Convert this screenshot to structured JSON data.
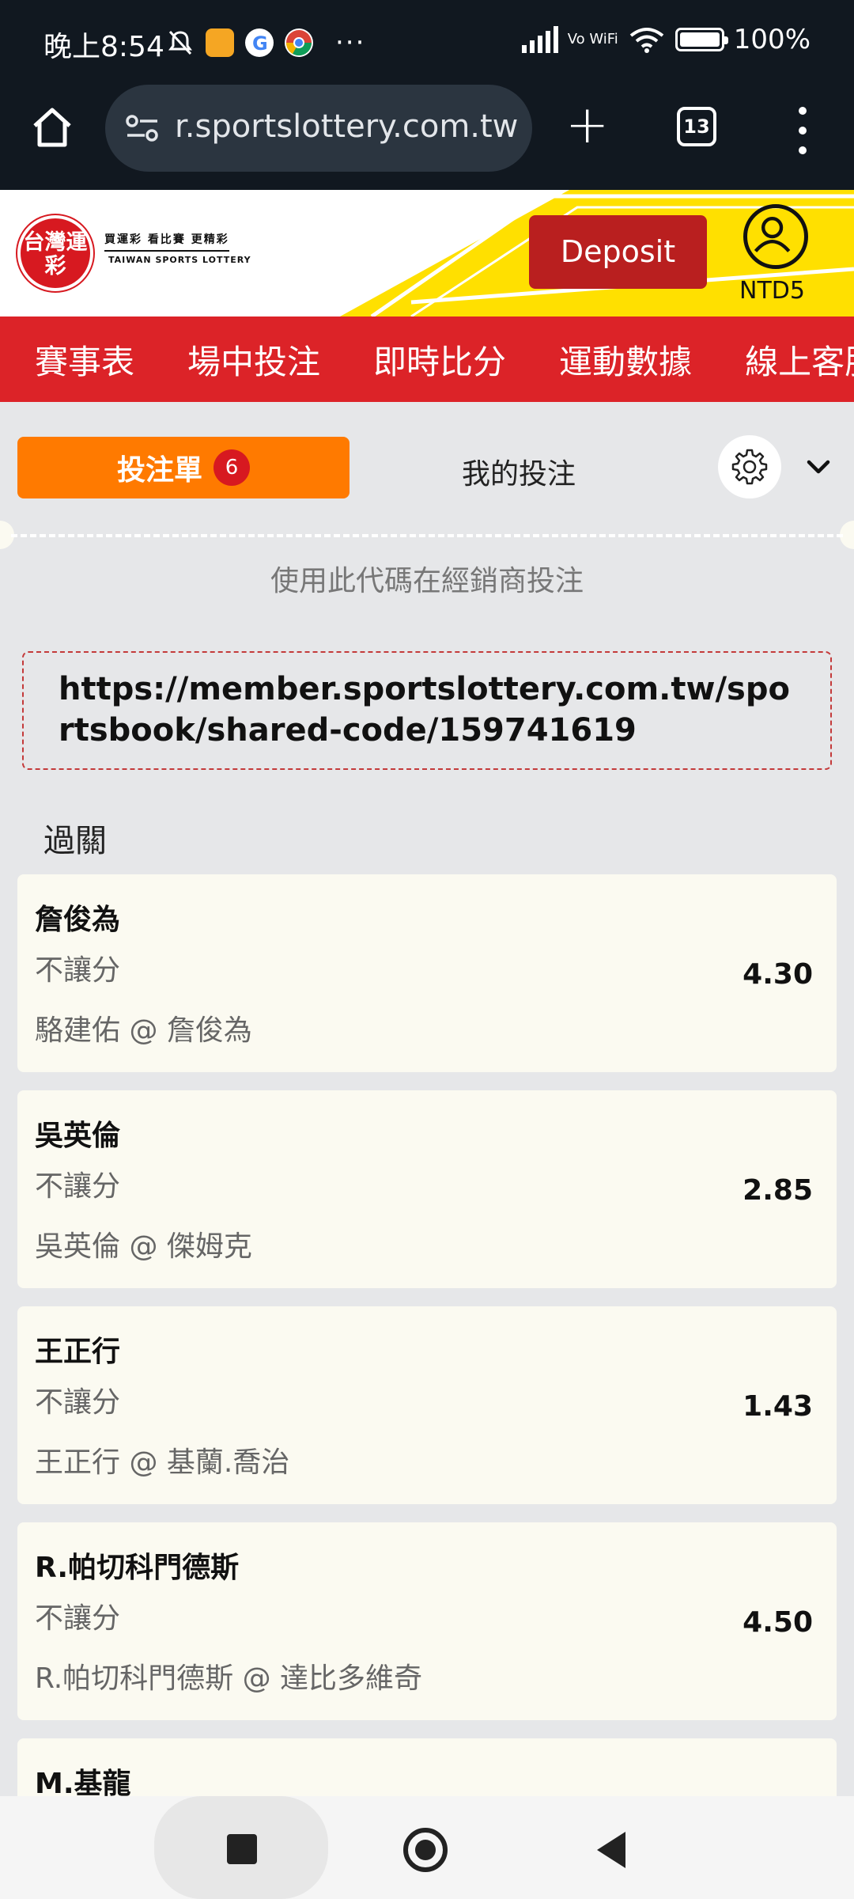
{
  "status_bar": {
    "time": "晚上8:54",
    "network": "Vo WiFi",
    "battery_percent": "100%",
    "battery_level": 1.0
  },
  "browser": {
    "url": "r.sportslottery.com.tw",
    "tab_count": "13"
  },
  "site_header": {
    "logo_text": "台灣運彩",
    "logo_slogan": "買運彩 看比賽 更精彩",
    "logo_english": "TAIWAN SPORTS LOTTERY",
    "deposit_label": "Deposit",
    "balance": "NTD5",
    "colors": {
      "red": "#dc2328",
      "yellow": "#ffe000",
      "deposit": "#b91f1f"
    }
  },
  "nav": {
    "items": [
      "賽事表",
      "場中投注",
      "即時比分",
      "運動數據",
      "線上客服"
    ]
  },
  "betslip": {
    "tab_active_label": "投注單",
    "tab_active_count": "6",
    "tab_mybets_label": "我的投注",
    "code_hint": "使用此代碼在經銷商投注",
    "share_code": "https://member.sportslottery.com.tw/sportsbook/shared-code/159741619",
    "section_label": "過關",
    "accent": "#ff7a00",
    "legs": [
      {
        "name": "詹俊為",
        "market": "不讓分",
        "match": "駱建佑 @ 詹俊為",
        "odds": "4.30"
      },
      {
        "name": "吳英倫",
        "market": "不讓分",
        "match": "吳英倫 @ 傑姆克",
        "odds": "2.85"
      },
      {
        "name": "王正行",
        "market": "不讓分",
        "match": "王正行 @ 基蘭.喬治",
        "odds": "1.43"
      },
      {
        "name": "R.帕切科門德斯",
        "market": "不讓分",
        "match": "R.帕切科門德斯 @ 達比多維奇",
        "odds": "4.50"
      },
      {
        "name": "M.基龍",
        "market": "",
        "match": "",
        "odds": ""
      }
    ]
  }
}
